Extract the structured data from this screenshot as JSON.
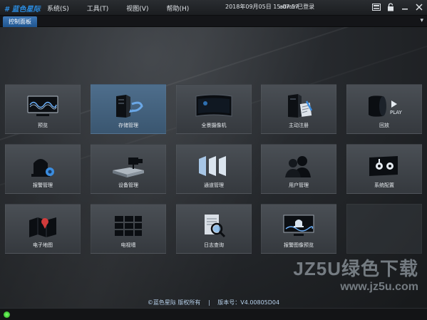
{
  "app": {
    "logo_text": "蓝色星际"
  },
  "menu": [
    {
      "label": "系统(S)"
    },
    {
      "label": "工具(T)"
    },
    {
      "label": "视图(V)"
    },
    {
      "label": "帮助(H)"
    }
  ],
  "status": {
    "datetime": "2018年09月05日 15:07:57",
    "login": "admin已登录"
  },
  "window_buttons": [
    "keyboard-icon",
    "lock-icon",
    "minimize-icon",
    "close-icon"
  ],
  "tabs": [
    {
      "label": "控制面板"
    }
  ],
  "tiles": [
    {
      "label": "预览",
      "icon": "monitor-wave-icon"
    },
    {
      "label": "存储管理",
      "icon": "storage-server-icon"
    },
    {
      "label": "全景摄像机",
      "icon": "panorama-camera-icon"
    },
    {
      "label": "主动注册",
      "icon": "active-register-icon"
    },
    {
      "label": "回放",
      "icon": "playback-film-icon"
    },
    {
      "label": "报警管理",
      "icon": "alarm-manage-icon"
    },
    {
      "label": "设备管理",
      "icon": "device-manage-icon"
    },
    {
      "label": "通道管理",
      "icon": "channel-manage-icon"
    },
    {
      "label": "用户管理",
      "icon": "users-icon"
    },
    {
      "label": "系统配置",
      "icon": "system-config-icon"
    },
    {
      "label": "电子地图",
      "icon": "e-map-icon"
    },
    {
      "label": "电视墙",
      "icon": "video-wall-icon"
    },
    {
      "label": "日志查询",
      "icon": "log-search-icon"
    },
    {
      "label": "报警图像预览",
      "icon": "alarm-image-preview-icon"
    },
    {
      "label": "",
      "icon": ""
    }
  ],
  "footer": {
    "copyright": "©蓝色星际 版权所有",
    "separator": "|",
    "version": "版本号：V4.00805D04"
  },
  "watermark": {
    "brand": "JZ5U绿色下载",
    "url": "www.jz5u.com"
  },
  "colors": {
    "accent": "#2b8ce0",
    "tab": "#2f6aa8",
    "active_tile": "#46647f",
    "status_ok": "#3ad62a"
  }
}
